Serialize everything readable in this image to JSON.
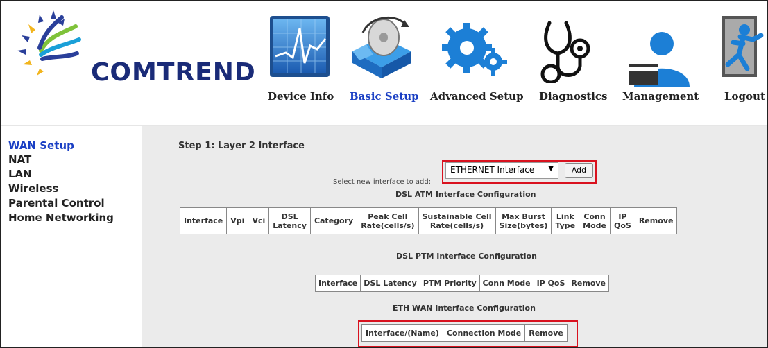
{
  "brand": {
    "name": "COMTREND"
  },
  "nav": [
    {
      "id": "device-info",
      "label": "Device Info",
      "icon": "monitor-chart-icon",
      "active": false
    },
    {
      "id": "basic-setup",
      "label": "Basic Setup",
      "icon": "box-disc-icon",
      "active": true
    },
    {
      "id": "advanced-setup",
      "label": "Advanced Setup",
      "icon": "gears-icon",
      "active": false
    },
    {
      "id": "diagnostics",
      "label": "Diagnostics",
      "icon": "stethoscope-icon",
      "active": false
    },
    {
      "id": "management",
      "label": "Management",
      "icon": "user-card-icon",
      "active": false
    },
    {
      "id": "logout",
      "label": "Logout",
      "icon": "exit-icon",
      "active": false
    }
  ],
  "sidebar": {
    "items": [
      {
        "label": "WAN Setup",
        "active": true
      },
      {
        "label": "NAT",
        "active": false
      },
      {
        "label": "LAN",
        "active": false
      },
      {
        "label": "Wireless",
        "active": false
      },
      {
        "label": "Parental Control",
        "active": false
      },
      {
        "label": "Home Networking",
        "active": false
      }
    ]
  },
  "main": {
    "step_title": "Step 1: Layer 2 Interface",
    "select_label": "Select new interface to add:",
    "selected_interface": "ETHERNET Interface",
    "add_label": "Add",
    "atm_title": "DSL ATM Interface Configuration",
    "atm_headers": [
      "Interface",
      "Vpi",
      "Vci",
      "DSL\nLatency",
      "Category",
      "Peak Cell\nRate(cells/s)",
      "Sustainable Cell\nRate(cells/s)",
      "Max Burst\nSize(bytes)",
      "Link\nType",
      "Conn\nMode",
      "IP\nQoS",
      "Remove"
    ],
    "ptm_title": "DSL PTM Interface Configuration",
    "ptm_headers": [
      "Interface",
      "DSL Latency",
      "PTM Priority",
      "Conn Mode",
      "IP QoS",
      "Remove"
    ],
    "eth_title": "ETH WAN Interface Configuration",
    "eth_headers": [
      "Interface/(Name)",
      "Connection Mode",
      "Remove"
    ]
  },
  "colors": {
    "active_link": "#1a3fc4",
    "highlight_box": "#d9121f",
    "panel_bg": "#ebebeb",
    "brand_text": "#1a2b78"
  }
}
